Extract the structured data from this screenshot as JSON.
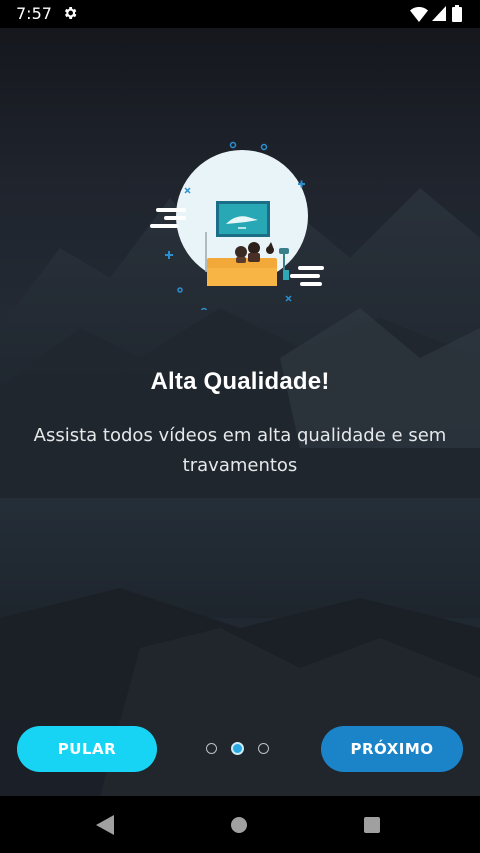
{
  "status_bar": {
    "time": "7:57",
    "icons": [
      "gear-icon",
      "wifi-icon",
      "signal-icon",
      "battery-icon"
    ]
  },
  "onboarding": {
    "title": "Alta Qualidade!",
    "subtitle": "Assista todos vídeos em alta qualidade e sem travamentos",
    "illustration": "couple-watching-tv-illustration",
    "page_indicator": {
      "total": 3,
      "current": 2
    }
  },
  "actions": {
    "skip_label": "PULAR",
    "next_label": "PRÓXIMO"
  },
  "colors": {
    "skip_button": "#17d4f5",
    "next_button": "#1b84c9",
    "active_dot": "#29a9e1"
  },
  "nav_bar": {
    "icons": [
      "back-icon",
      "home-icon",
      "recents-icon"
    ]
  }
}
